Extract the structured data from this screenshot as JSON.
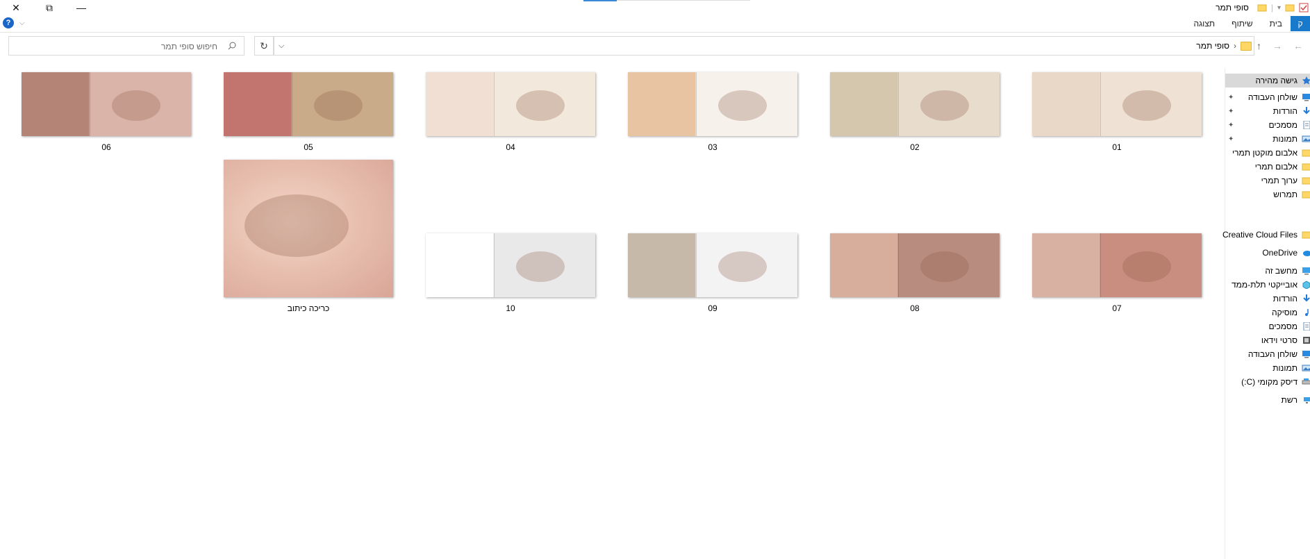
{
  "window": {
    "title": "סופי תמר",
    "close_glyph": "✕",
    "maximize_glyph": "⧉",
    "minimize_glyph": "—"
  },
  "ribbon": {
    "file_tab": "ק",
    "tabs": [
      "בית",
      "שיתוף",
      "תצוגה"
    ]
  },
  "address_bar": {
    "path": "סופי תמר",
    "refresh_glyph": "↻",
    "dropdown_glyph": "⌵"
  },
  "search": {
    "placeholder": "חיפוש סופי תמר"
  },
  "nav_pane": {
    "quick_access_label": "גישה מהירה",
    "quick_access_items": [
      {
        "label": "שולחן העבודה",
        "icon": "desktop-icon",
        "pinned": true
      },
      {
        "label": "הורדות",
        "icon": "downloads-icon",
        "pinned": true
      },
      {
        "label": "מסמכים",
        "icon": "documents-icon",
        "pinned": true
      },
      {
        "label": "תמונות",
        "icon": "pictures-icon",
        "pinned": true
      },
      {
        "label": "אלבום מוקטן תמרי",
        "icon": "folder-icon",
        "pinned": false
      },
      {
        "label": "אלבום תמרי",
        "icon": "folder-icon",
        "pinned": false
      },
      {
        "label": "ערוך תמרי",
        "icon": "folder-icon",
        "pinned": false
      },
      {
        "label": "תמרוש",
        "icon": "folder-icon",
        "pinned": false
      }
    ],
    "creative_cloud": "Creative Cloud Files",
    "onedrive": "OneDrive",
    "this_pc": "מחשב זה",
    "this_pc_items": [
      {
        "label": "אובייקטי תלת-ממד",
        "icon": "3d-objects-icon"
      },
      {
        "label": "הורדות",
        "icon": "downloads-icon"
      },
      {
        "label": "מוסיקה",
        "icon": "music-icon"
      },
      {
        "label": "מסמכים",
        "icon": "documents-icon"
      },
      {
        "label": "סרטי וידאו",
        "icon": "videos-icon"
      },
      {
        "label": "שולחן העבודה",
        "icon": "desktop-icon"
      },
      {
        "label": "תמונות",
        "icon": "pictures-icon"
      },
      {
        "label": "דיסק מקומי (C:)",
        "icon": "drive-icon"
      }
    ],
    "network": "רשת"
  },
  "files": [
    {
      "name": "01",
      "colors": [
        "#efe1d3",
        "#e9d7c8"
      ]
    },
    {
      "name": "02",
      "colors": [
        "#e8dccd",
        "#d4c7ad"
      ]
    },
    {
      "name": "03",
      "colors": [
        "#f6f1ea",
        "#e9c4a2"
      ]
    },
    {
      "name": "04",
      "colors": [
        "#f2e8dc",
        "#f0dfd2"
      ]
    },
    {
      "name": "05",
      "colors": [
        "#c9ab8a",
        "#c2756f"
      ]
    },
    {
      "name": "06",
      "colors": [
        "#dab4a8",
        "#b48576"
      ]
    },
    {
      "name": "07",
      "colors": [
        "#c98e80",
        "#d9b1a2"
      ]
    },
    {
      "name": "08",
      "colors": [
        "#b98c80",
        "#d7ad9c"
      ]
    },
    {
      "name": "09",
      "colors": [
        "#f3f3f3",
        "#c7b9aa"
      ]
    },
    {
      "name": "10",
      "colors": [
        "#e9e9e9",
        "#ffffff"
      ]
    },
    {
      "name": "כריכה כיתוב",
      "colors": [
        "#e8c0b0",
        "#d9a597"
      ]
    }
  ]
}
